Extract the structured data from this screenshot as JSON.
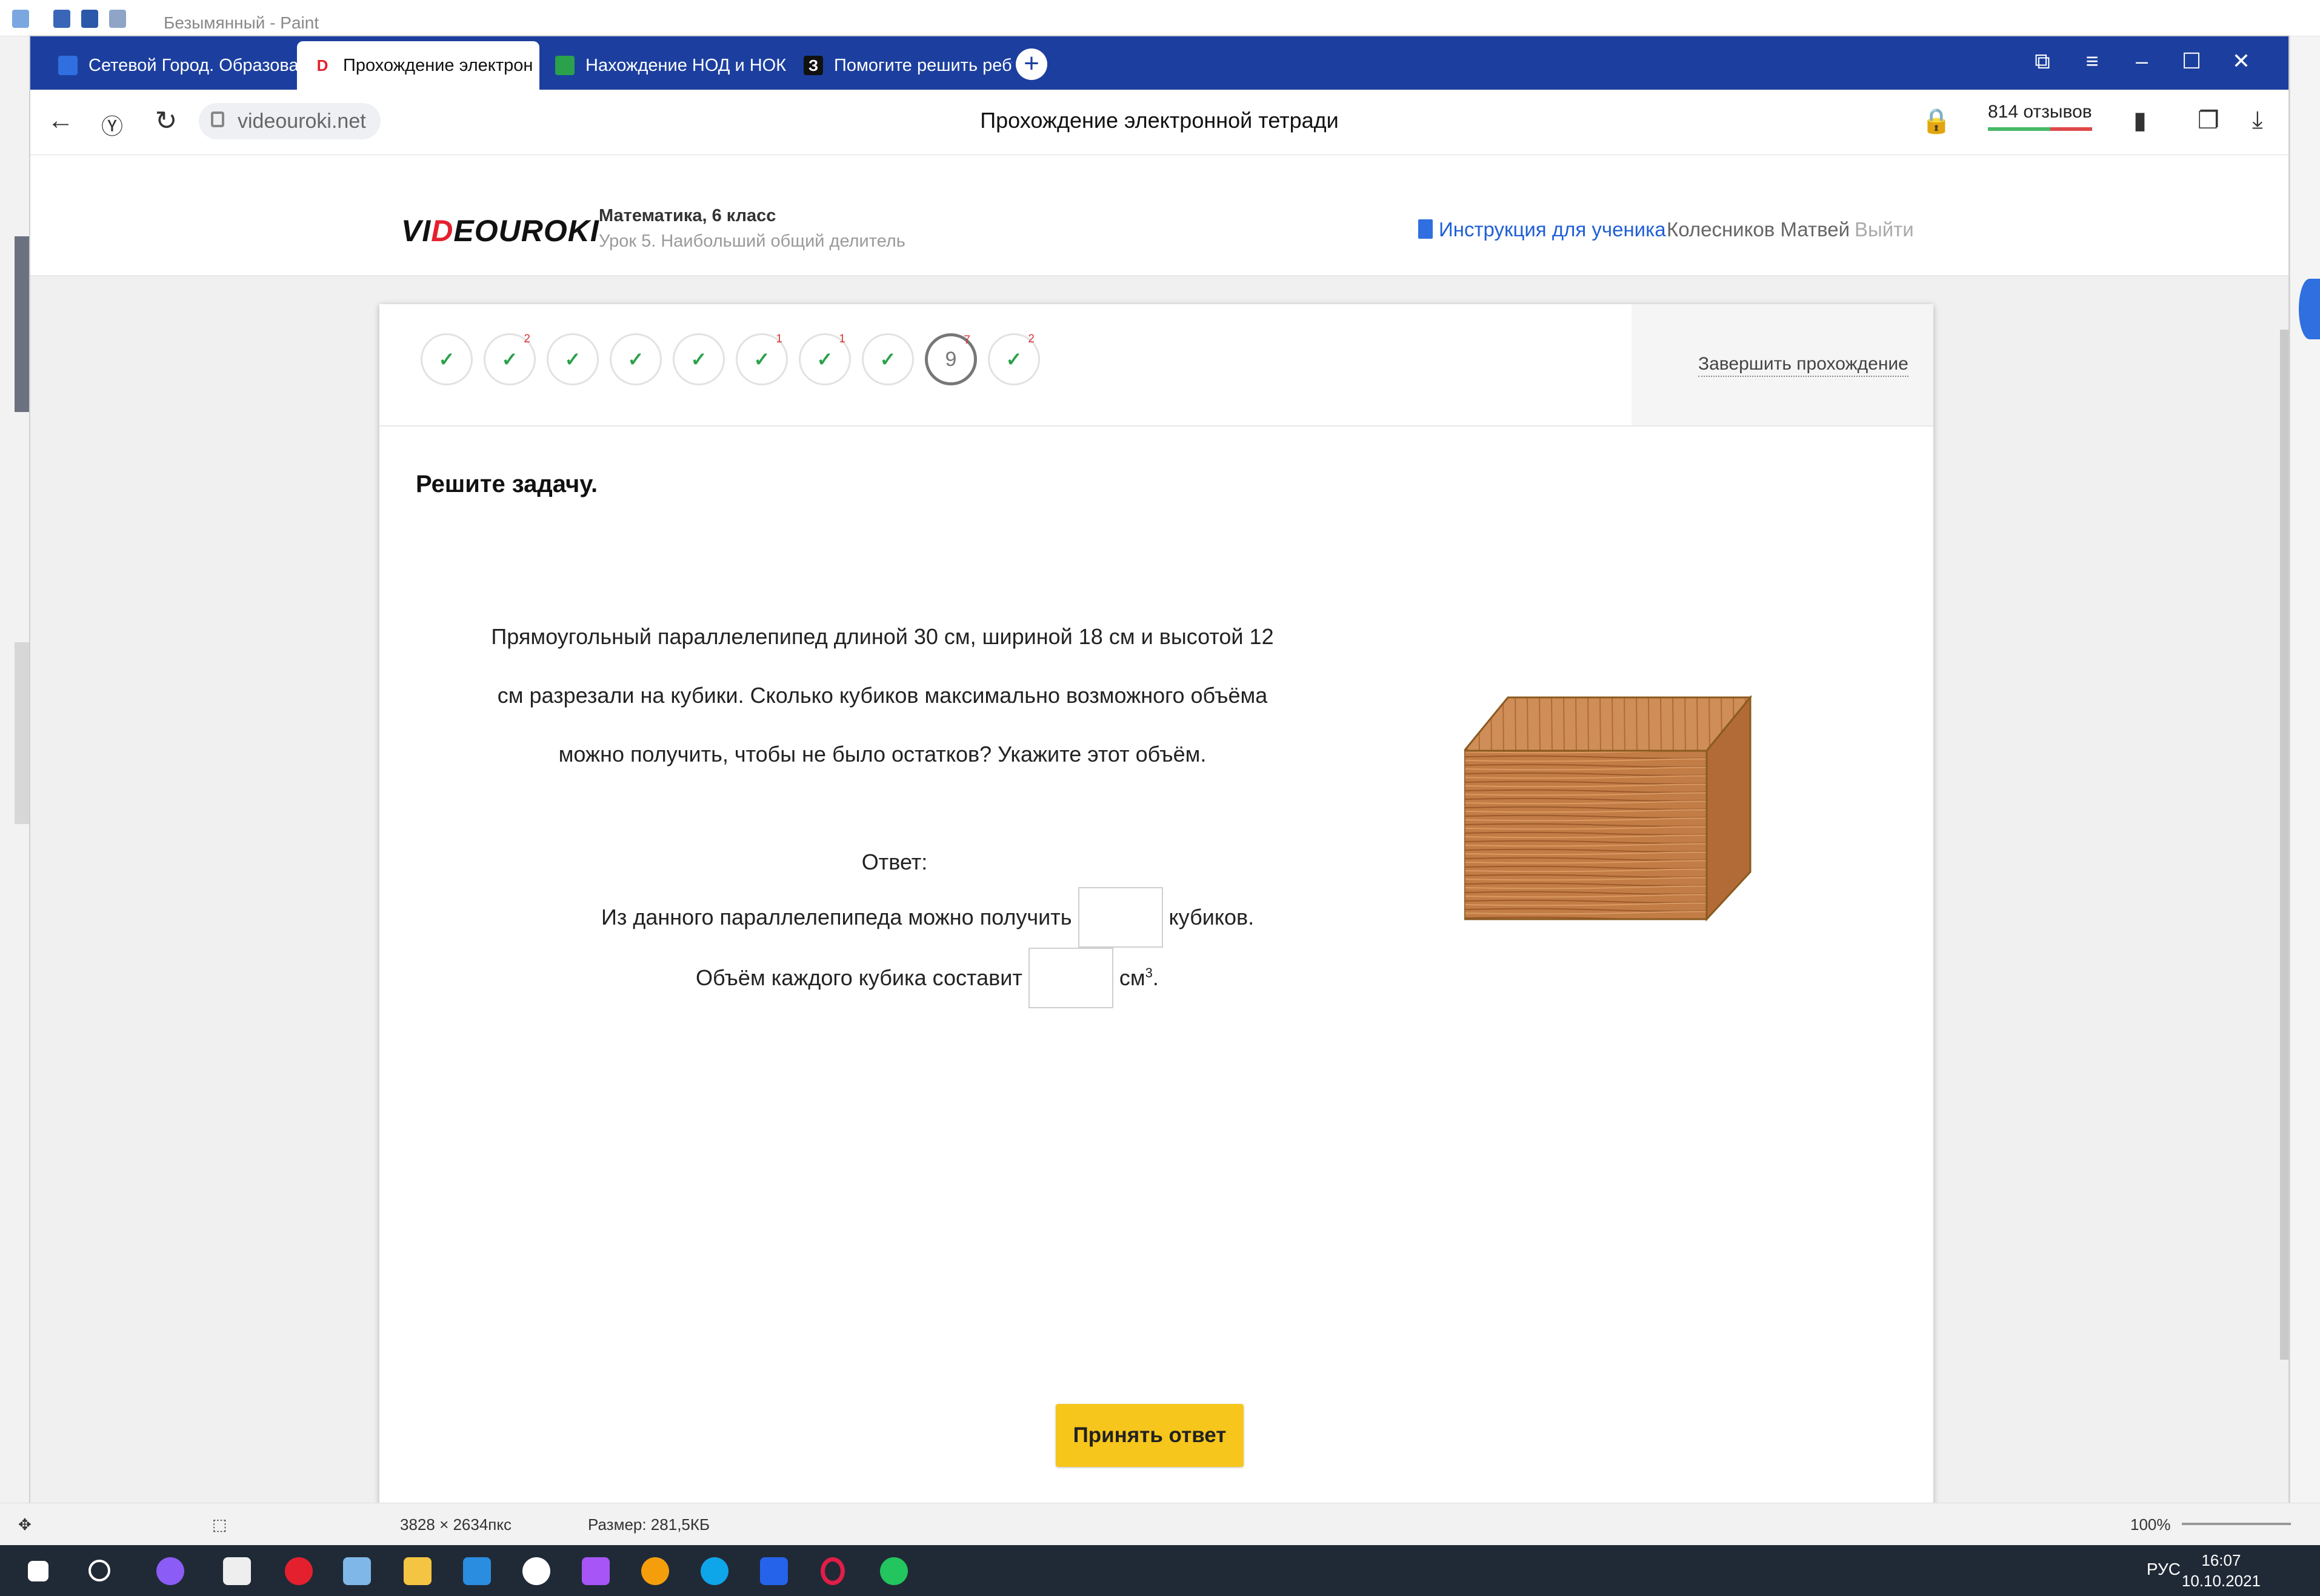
{
  "paint": {
    "title": "Безымянный - Paint",
    "size_text": "3828 × 2634пкс",
    "file_size": "Размер: 281,5КБ",
    "zoom": "100%"
  },
  "tabs": [
    {
      "label": "Сетевой Город. Образова",
      "fav_color": "#2f6fe0"
    },
    {
      "label": "Прохождение электрон",
      "fav_color": "#e5202e",
      "fav_glyph": "D",
      "active": true
    },
    {
      "label": "Нахождение НОД и НОК",
      "fav_color": "#2aa14a"
    },
    {
      "label": "Помогите решить ребус п",
      "fav_color": "#111111",
      "fav_glyph": "З"
    }
  ],
  "address": {
    "url": "videouroki.net",
    "page_title": "Прохождение электронной тетради",
    "reviews": "814 отзывов"
  },
  "site": {
    "logo_pre": "VI",
    "logo_d": "D",
    "logo_post": "EOUROKI",
    "course": "Математика, 6 класс",
    "lesson": "Урок 5. Наибольший общий делитель",
    "instructions": "Инструкция для ученика",
    "user": "Колесников Матвей",
    "logout": "Выйти"
  },
  "progress": {
    "steps": [
      {
        "mark": "✓",
        "sup": ""
      },
      {
        "mark": "✓",
        "sup": "2"
      },
      {
        "mark": "✓",
        "sup": ""
      },
      {
        "mark": "✓",
        "sup": ""
      },
      {
        "mark": "✓",
        "sup": ""
      },
      {
        "mark": "✓",
        "sup": "1"
      },
      {
        "mark": "✓",
        "sup": "1"
      },
      {
        "mark": "✓",
        "sup": ""
      },
      {
        "mark": "9",
        "sup": "7",
        "current": true
      },
      {
        "mark": "✓",
        "sup": "2"
      }
    ],
    "finish": "Завершить прохождение"
  },
  "task": {
    "title": "Решите задачу.",
    "problem": "Прямоугольный параллелепипед  длиной 30 см, шириной 18 см и высотой 12 см разрезали на кубики. Сколько кубиков максимально возможного объёма можно получить, чтобы не было остатков? Укажите этот объём.",
    "answer_label": "Ответ:",
    "line1_before": "Из данного параллелепипеда можно получить",
    "line1_after": "кубиков.",
    "line2_before": "Объём каждого кубика составит",
    "line2_unit": "см",
    "line2_sup": "3",
    "line2_end": ".",
    "submit": "Принять ответ"
  },
  "tray": {
    "lang": "РУС",
    "time": "16:07",
    "date": "10.10.2021"
  }
}
